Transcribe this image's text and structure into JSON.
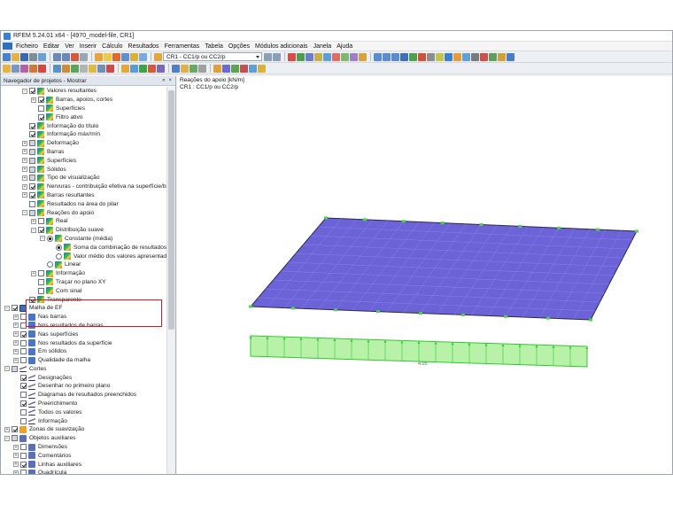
{
  "window": {
    "title": "RFEM 5.24.01 x64 - [4970_model-file, CR1]"
  },
  "menu": {
    "items": [
      "Ficheiro",
      "Editar",
      "Ver",
      "Inserir",
      "Cálculo",
      "Resultados",
      "Ferramentas",
      "Tabela",
      "Opções",
      "Módulos adicionais",
      "Janela",
      "Ajuda"
    ]
  },
  "toolbar": {
    "load_combo_value": "CR1 - CC1/p ou CC2/p"
  },
  "navigator": {
    "title": "Navegador de projetos - Mostrar",
    "header_controls": [
      "«",
      "×"
    ],
    "items": [
      {
        "label": "Valores resultantes",
        "level": 2,
        "tw": "−",
        "cb": "on",
        "icon": "grad"
      },
      {
        "label": "Barras, apoios, cortes",
        "level": 3,
        "tw": "+",
        "cb": "on",
        "icon": "grad"
      },
      {
        "label": "Superfícies",
        "level": 3,
        "tw": "",
        "cb": "off",
        "icon": "grad"
      },
      {
        "label": "Filtro ativo",
        "level": 3,
        "tw": "",
        "cb": "on",
        "icon": "grad"
      },
      {
        "label": "Informação do título",
        "level": 2,
        "tw": "",
        "cb": "on",
        "icon": "grad"
      },
      {
        "label": "Informação máx/mín",
        "level": 2,
        "tw": "",
        "cb": "on",
        "icon": "grad"
      },
      {
        "label": "Deformação",
        "level": 2,
        "tw": "+",
        "cb": "partial",
        "icon": "grad"
      },
      {
        "label": "Barras",
        "level": 2,
        "tw": "+",
        "cb": "partial",
        "icon": "grad"
      },
      {
        "label": "Superfícies",
        "level": 2,
        "tw": "+",
        "cb": "partial",
        "icon": "grad"
      },
      {
        "label": "Sólidos",
        "level": 2,
        "tw": "+",
        "cb": "partial",
        "icon": "grad"
      },
      {
        "label": "Tipo de visualização",
        "level": 2,
        "tw": "+",
        "cb": "partial",
        "icon": "grad"
      },
      {
        "label": "Nervuras - contribuição efetiva na superfície/barra",
        "level": 2,
        "tw": "+",
        "cb": "on",
        "icon": "grad"
      },
      {
        "label": "Barras resultantes",
        "level": 2,
        "tw": "+",
        "cb": "on",
        "icon": "grad"
      },
      {
        "label": "Resultados na área do pilar",
        "level": 2,
        "tw": "",
        "cb": "off",
        "icon": "grad"
      },
      {
        "label": "Reações do apoio",
        "level": 2,
        "tw": "−",
        "cb": "partial",
        "icon": "grad"
      },
      {
        "label": "Real",
        "level": 3,
        "tw": "+",
        "cb": "off",
        "icon": "grad"
      },
      {
        "label": "Distribuição suave",
        "level": 3,
        "tw": "−",
        "cb": "on",
        "icon": "grad"
      },
      {
        "label": "Constante (média)",
        "level": 4,
        "tw": "−",
        "cb": "radio-on",
        "icon": "grad"
      },
      {
        "label": "Soma da combinação de resultados",
        "level": 5,
        "tw": "",
        "cb": "radio-on",
        "icon": "grad"
      },
      {
        "label": "Valor médio dos valores apresentados",
        "level": 5,
        "tw": "",
        "cb": "radio-off",
        "icon": "grad"
      },
      {
        "label": "Linear",
        "level": 4,
        "tw": "",
        "cb": "radio-off",
        "icon": "grad"
      },
      {
        "label": "Informação",
        "level": 3,
        "tw": "+",
        "cb": "off",
        "icon": "grad"
      },
      {
        "label": "Traçar no plano XY",
        "level": 3,
        "tw": "",
        "cb": "off",
        "icon": "grad"
      },
      {
        "label": "Com sinal",
        "level": 3,
        "tw": "",
        "cb": "off",
        "icon": "grad"
      },
      {
        "label": "Transparente",
        "level": 2,
        "tw": "",
        "cb": "on",
        "icon": "grad"
      },
      {
        "label": "Malha de EF",
        "level": 0,
        "tw": "−",
        "cb": "on",
        "icon": "mesh"
      },
      {
        "label": "Nas barras",
        "level": 1,
        "tw": "+",
        "cb": "off",
        "icon": "blue"
      },
      {
        "label": "Nos resultados de barras",
        "level": 1,
        "tw": "+",
        "cb": "off",
        "icon": "blue"
      },
      {
        "label": "Nas superfícies",
        "level": 1,
        "tw": "+",
        "cb": "on",
        "icon": "blue"
      },
      {
        "label": "Nos resultados da superfície",
        "level": 1,
        "tw": "+",
        "cb": "off",
        "icon": "blue"
      },
      {
        "label": "Em sólidos",
        "level": 1,
        "tw": "+",
        "cb": "off",
        "icon": "blue"
      },
      {
        "label": "Qualidade da malha",
        "level": 1,
        "tw": "+",
        "cb": "off",
        "icon": "blue"
      },
      {
        "label": "Cortes",
        "level": 0,
        "tw": "−",
        "cb": "partial",
        "icon": "line"
      },
      {
        "label": "Designações",
        "level": 1,
        "tw": "",
        "cb": "on",
        "icon": "line"
      },
      {
        "label": "Desenhar no primeiro plano",
        "level": 1,
        "tw": "",
        "cb": "on",
        "icon": "line"
      },
      {
        "label": "Diagramas de resultados preenchidos",
        "level": 1,
        "tw": "",
        "cb": "off",
        "icon": "line"
      },
      {
        "label": "Preenchimento",
        "level": 1,
        "tw": "",
        "cb": "on",
        "icon": "line"
      },
      {
        "label": "Todos os valores",
        "level": 1,
        "tw": "",
        "cb": "off",
        "icon": "line"
      },
      {
        "label": "Informação",
        "level": 1,
        "tw": "",
        "cb": "off",
        "icon": "line"
      },
      {
        "label": "Zonas de suavização",
        "level": 0,
        "tw": "+",
        "cb": "on",
        "icon": "orange"
      },
      {
        "label": "Objetos auxiliares",
        "level": 0,
        "tw": "−",
        "cb": "partial",
        "icon": "aux"
      },
      {
        "label": "Dimensões",
        "level": 1,
        "tw": "+",
        "cb": "off",
        "icon": "aux"
      },
      {
        "label": "Comentários",
        "level": 1,
        "tw": "+",
        "cb": "off",
        "icon": "aux"
      },
      {
        "label": "Linhas auxiliares",
        "level": 1,
        "tw": "+",
        "cb": "on",
        "icon": "aux"
      },
      {
        "label": "Quadrícula",
        "level": 1,
        "tw": "+",
        "cb": "off",
        "icon": "aux"
      }
    ]
  },
  "viewport": {
    "line1": "Reações do apoio [kN/m]",
    "line2": "CR1 : CC1/p ou CC2/p",
    "result_value_label": "4.95",
    "colors": {
      "slab": "#6c63d8",
      "slab_edge": "#2a2a48",
      "diagram_fill": "#b8f2a8",
      "diagram_line": "#2fc82f"
    }
  }
}
